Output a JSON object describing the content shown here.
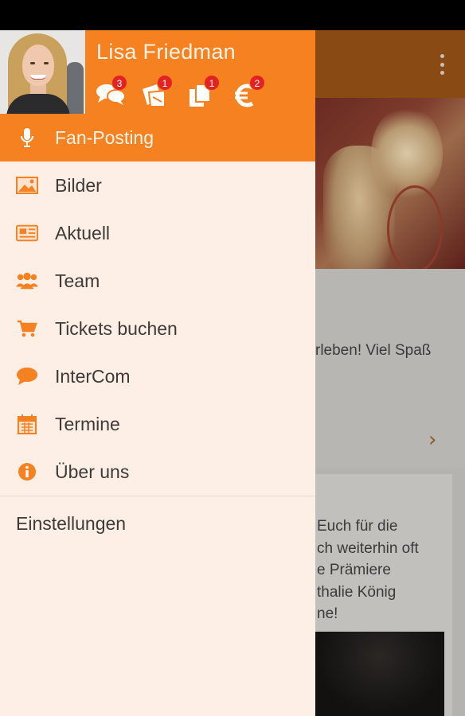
{
  "background": {
    "snippet1": "rleben! Viel Spaß",
    "chevron": "›",
    "snippet2": [
      "Euch für die",
      "ch weiterhin oft",
      "e Prämiere",
      "thalie König",
      "ne!"
    ]
  },
  "drawer": {
    "user_name": "Lisa Friedman",
    "stats": [
      {
        "icon": "chat-bubbles-icon",
        "count": "3"
      },
      {
        "icon": "tickets-icon",
        "count": "1"
      },
      {
        "icon": "documents-icon",
        "count": "1"
      },
      {
        "icon": "euro-icon",
        "count": "2"
      }
    ],
    "items": [
      {
        "label": "Fan-Posting",
        "icon": "microphone-icon",
        "active": true
      },
      {
        "label": "Bilder",
        "icon": "image-icon"
      },
      {
        "label": "Aktuell",
        "icon": "newspaper-icon"
      },
      {
        "label": "Team",
        "icon": "group-icon"
      },
      {
        "label": "Tickets buchen",
        "icon": "cart-icon"
      },
      {
        "label": "InterCom",
        "icon": "speech-bubble-icon"
      },
      {
        "label": "Termine",
        "icon": "calendar-icon"
      },
      {
        "label": "Über uns",
        "icon": "info-icon"
      }
    ],
    "settings_label": "Einstellungen"
  },
  "colors": {
    "accent": "#f68120",
    "drawer_bg": "#fdefe6",
    "badge": "#e32222"
  }
}
